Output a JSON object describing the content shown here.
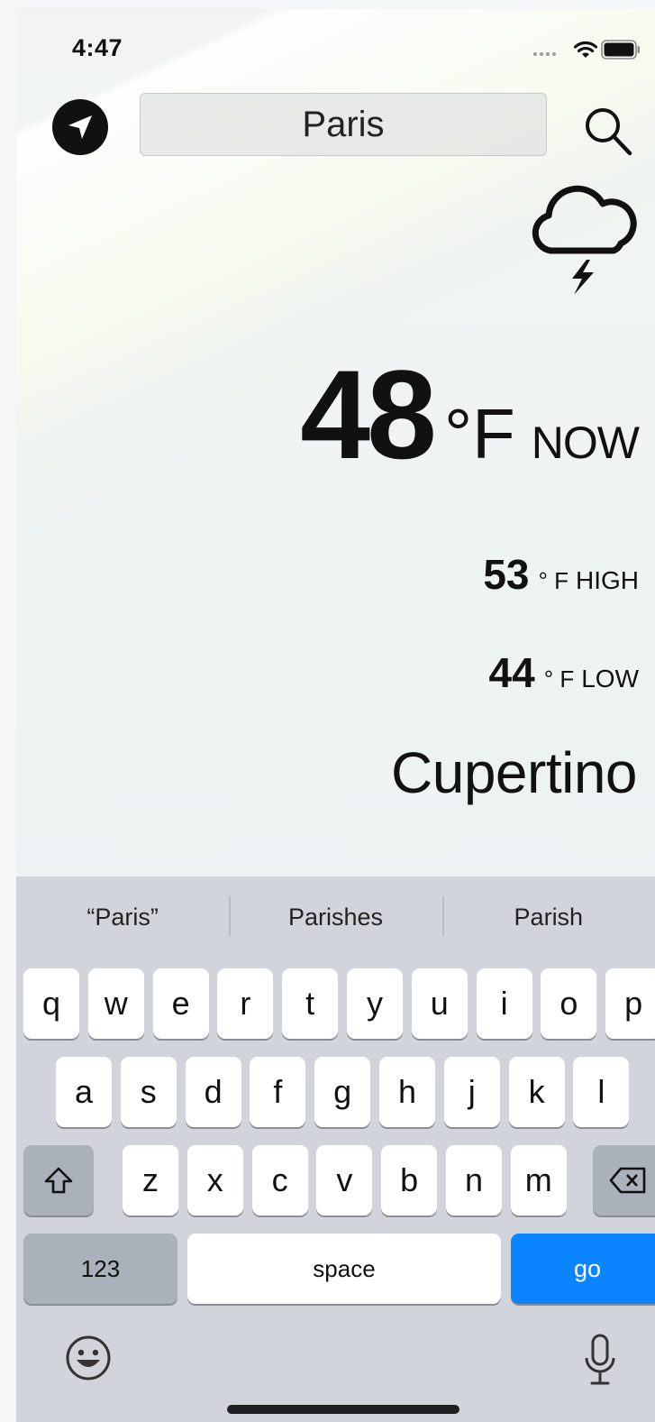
{
  "status_bar": {
    "time": "4:47"
  },
  "search": {
    "value": "Paris"
  },
  "weather": {
    "current_value": "48",
    "current_unit": "°F",
    "current_label": "NOW",
    "high_value": "53",
    "high_unit": "° F",
    "high_label": "HIGH",
    "low_value": "44",
    "low_unit": "° F",
    "low_label": "LOW",
    "city": "Cupertino",
    "condition_icon": "thunderstorm-cloud-icon"
  },
  "keyboard": {
    "suggestions": [
      "“Paris”",
      "Parishes",
      "Parish"
    ],
    "row1": [
      "q",
      "w",
      "e",
      "r",
      "t",
      "y",
      "u",
      "i",
      "o",
      "p"
    ],
    "row2": [
      "a",
      "s",
      "d",
      "f",
      "g",
      "h",
      "j",
      "k",
      "l"
    ],
    "row3": [
      "z",
      "x",
      "c",
      "v",
      "b",
      "n",
      "m"
    ],
    "numbers_label": "123",
    "space_label": "space",
    "go_label": "go"
  },
  "colors": {
    "accent": "#0a84ff",
    "keyboard_bg": "#d1d5db"
  }
}
